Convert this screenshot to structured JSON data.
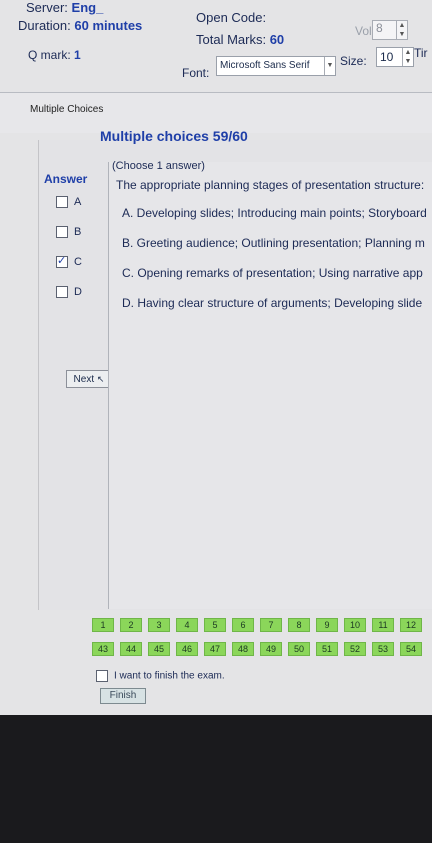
{
  "header": {
    "server_label": "Server:",
    "server_value": "Eng_",
    "duration_label": "Duration:",
    "duration_value": "60 minutes",
    "qmark_label": "Q mark:",
    "qmark_value": "1",
    "open_code_label": "Open Code:",
    "total_marks_label": "Total Marks:",
    "total_marks_value": "60",
    "vol_label": "Vol:",
    "vol_value": "8",
    "font_label": "Font:",
    "font_value": "Microsoft Sans Serif",
    "size_label": "Size:",
    "size_value": "10",
    "time_label": "Tir"
  },
  "section": {
    "label": "Multiple Choices"
  },
  "panel": {
    "title": "Multiple choices 59/60",
    "answer_label": "Answer",
    "options": [
      {
        "label": "A",
        "checked": false
      },
      {
        "label": "B",
        "checked": false
      },
      {
        "label": "C",
        "checked": true
      },
      {
        "label": "D",
        "checked": false
      }
    ],
    "next_label": "Next"
  },
  "question": {
    "instruction": "(Choose 1 answer)",
    "text": "The appropriate planning stages of presentation structure:",
    "answers": [
      "A. Developing slides; Introducing main points; Storyboard",
      "B. Greeting audience; Outlining presentation; Planning m",
      "C. Opening remarks of presentation; Using narrative app",
      "D. Having clear structure of arguments; Developing slide"
    ]
  },
  "navigator": {
    "row1": [
      "1",
      "2",
      "3",
      "4",
      "5",
      "6",
      "7",
      "8",
      "9",
      "10",
      "11",
      "12"
    ],
    "row2": [
      "43",
      "44",
      "45",
      "46",
      "47",
      "48",
      "49",
      "50",
      "51",
      "52",
      "53",
      "54"
    ],
    "finish_check_label": "I want to finish the exam.",
    "finish_button": "Finish"
  },
  "colors": {
    "accent_blue": "#1f3fa8",
    "answered_green": "#8bd65a"
  }
}
